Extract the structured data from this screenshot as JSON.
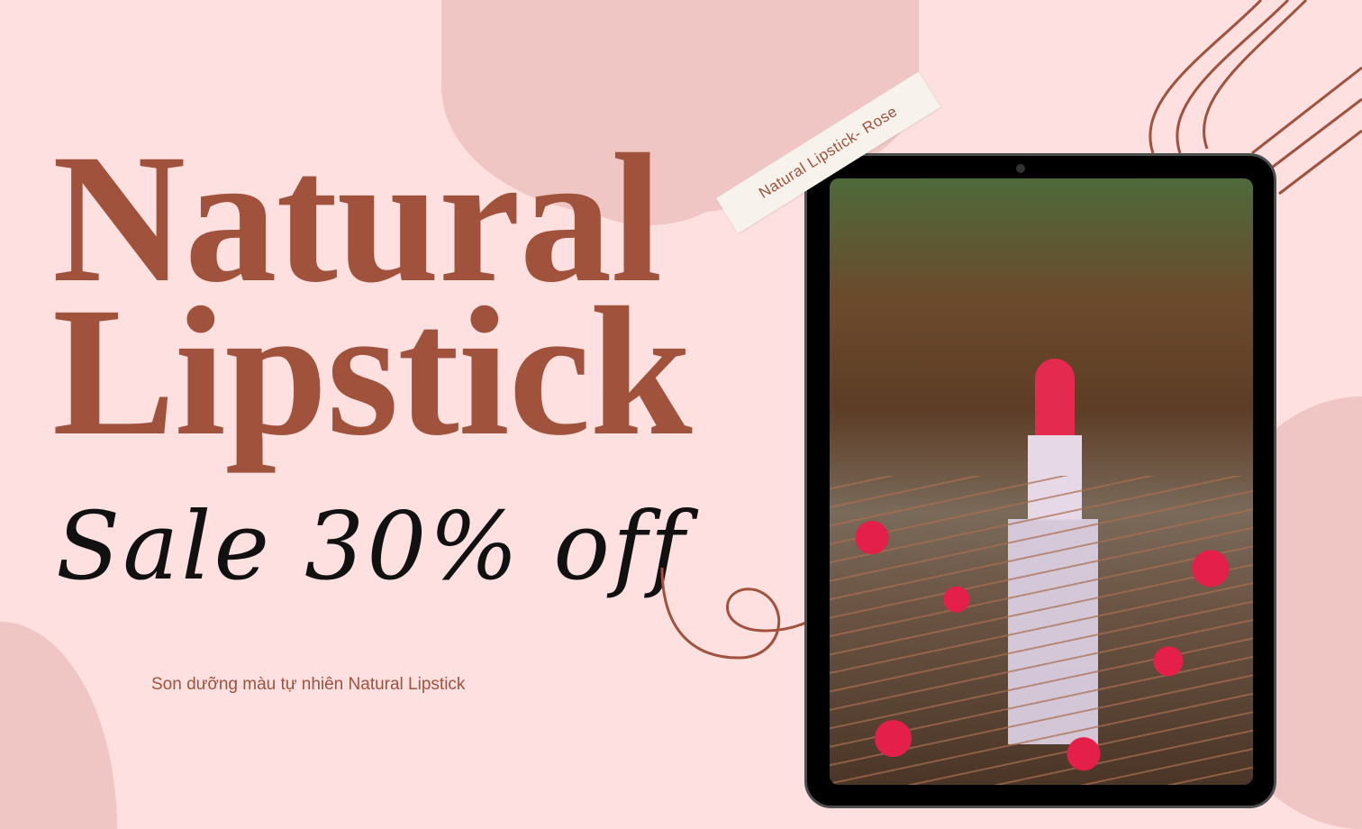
{
  "headline": {
    "line1": "Natural",
    "line2": "Lipstick"
  },
  "promo": "Sale 30% off",
  "subtitle": "Son dưỡng màu tự nhiên Natural Lipstick",
  "tape_label": "Natural Lipstick- Rose",
  "colors": {
    "background": "#fde0df",
    "blob": "#efc6c4",
    "accent": "#a0523d",
    "text_dark": "#111111"
  }
}
